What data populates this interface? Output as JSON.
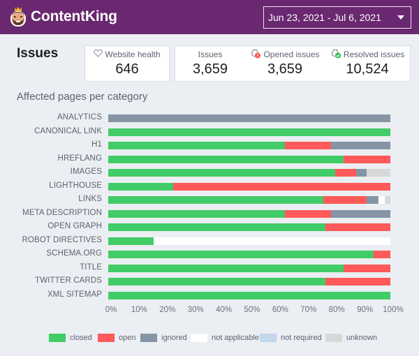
{
  "header": {
    "brand": "ContentKing",
    "date_range": "Jun 23, 2021 - Jul 6, 2021"
  },
  "page_title": "Issues",
  "metrics": {
    "website_health": {
      "label": "Website health",
      "value": "646",
      "icon": "heart-icon"
    },
    "issues": {
      "label": "Issues",
      "value": "3,659"
    },
    "opened_issues": {
      "label": "Opened issues",
      "value": "3,659",
      "icon": "bug-alert-icon"
    },
    "resolved_issues": {
      "label": "Resolved issues",
      "value": "10,524",
      "icon": "bug-check-icon"
    }
  },
  "colors": {
    "closed": "#42cc67",
    "open": "#ff5959",
    "ignored": "#8595a6",
    "not_applicable": "#ffffff",
    "not_required": "#c2d6ec",
    "unknown": "#d8d8d8",
    "brand": "#69286f"
  },
  "chart_data": {
    "type": "bar",
    "orientation": "horizontal",
    "stacked": true,
    "normalized": true,
    "title": "Affected pages per category",
    "xlabel": "",
    "ylabel": "",
    "xlim": [
      0,
      100
    ],
    "x_ticks": [
      "0%",
      "10%",
      "20%",
      "30%",
      "40%",
      "50%",
      "60%",
      "70%",
      "80%",
      "90%",
      "100%"
    ],
    "legend_position": "bottom",
    "categories": [
      "ANALYTICS",
      "CANONICAL LINK",
      "H1",
      "HREFLANG",
      "IMAGES",
      "LIGHTHOUSE",
      "LINKS",
      "META DESCRIPTION",
      "OPEN GRAPH",
      "ROBOT DIRECTIVES",
      "SCHEMA.ORG",
      "TITLE",
      "TWITTER CARDS",
      "XML SITEMAP"
    ],
    "series": [
      {
        "name": "closed",
        "key": "closed",
        "values": [
          0,
          100,
          62.6,
          83.4,
          80.4,
          22.9,
          76.2,
          62.6,
          77.0,
          16.1,
          94.1,
          83.4,
          77.0,
          100
        ]
      },
      {
        "name": "open",
        "key": "open",
        "values": [
          0,
          0,
          16.4,
          16.6,
          7.5,
          77.1,
          15.4,
          16.4,
          23.0,
          0,
          5.9,
          16.6,
          23.0,
          0
        ]
      },
      {
        "name": "ignored",
        "key": "ignored",
        "values": [
          100,
          0,
          21.0,
          0,
          3.7,
          0,
          4.2,
          21.0,
          0,
          0,
          0,
          0,
          0,
          0
        ]
      },
      {
        "name": "not applicable",
        "key": "not_applicable",
        "values": [
          0,
          0,
          0,
          0,
          0,
          0,
          2.2,
          0,
          0,
          83.9,
          0,
          0,
          0,
          0
        ]
      },
      {
        "name": "not required",
        "key": "not_required",
        "values": [
          0,
          0,
          0,
          0,
          0,
          0,
          0,
          0,
          0,
          0,
          0,
          0,
          0,
          0
        ]
      },
      {
        "name": "unknown",
        "key": "unknown",
        "values": [
          0,
          0,
          0,
          0,
          8.4,
          0,
          2.0,
          0,
          0,
          0,
          0,
          0,
          0,
          0
        ]
      }
    ]
  }
}
